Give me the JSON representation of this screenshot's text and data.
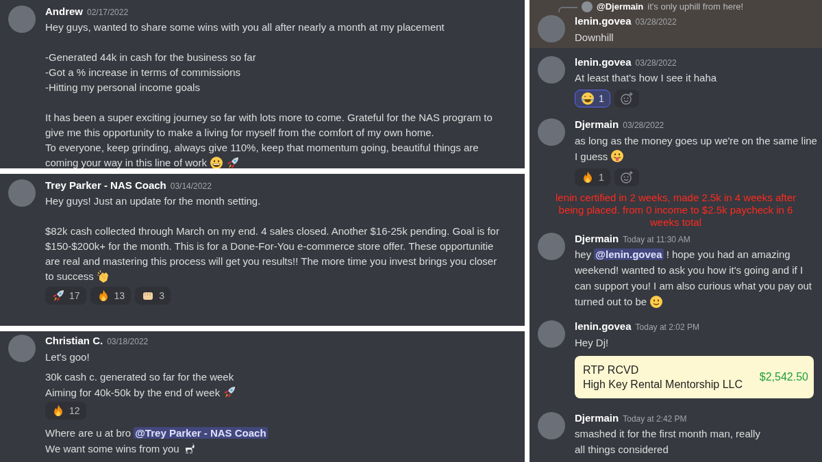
{
  "panels": [
    {
      "items": [
        {
          "kind": "message",
          "author": "Andrew",
          "timestamp": "02/17/2022",
          "paragraphs": [
            [
              {
                "text": "Hey guys, wanted to share some wins with you all after nearly a month at my placement"
              }
            ],
            [
              {
                "text": "-Generated 44k in cash for the business so far"
              },
              {
                "text": "-Got a % increase in terms of commissions"
              },
              {
                "text": "-Hitting my personal income goals"
              }
            ],
            [
              {
                "text": "It has been a super exciting journey so far with lots more to come. Grateful for the NAS program to"
              },
              {
                "text": "give me this opportunity to make a living for myself from the comfort of my own home."
              },
              {
                "text": "To everyone, keep grinding, always give 110%, keep that momentum going, beautiful things are"
              },
              {
                "text": "coming your way in this line of work",
                "emojis": [
                  {
                    "kind": "grin"
                  },
                  {
                    "kind": "rocket"
                  }
                ]
              }
            ]
          ]
        }
      ]
    },
    {
      "items": [
        {
          "kind": "message",
          "author": "Trey Parker - NAS Coach",
          "timestamp": "03/14/2022",
          "paragraphs": [
            [
              {
                "text": "Hey guys! Just an update for the month setting."
              }
            ],
            [
              {
                "text": "$82k cash collected through March on my end. 4 sales closed. Another $16-25k pending. Goal is for"
              },
              {
                "text": "$150-$200k+ for the month. This is for a Done-For-You e-commerce store offer. These opportunitie"
              },
              {
                "text": "are real and mastering this process will get you results!! The more time you invest brings you closer"
              },
              {
                "text": "to success",
                "emojis": [
                  {
                    "kind": "clap"
                  }
                ]
              }
            ]
          ],
          "reactions": [
            {
              "kind": "rocket",
              "count": "17",
              "selected": false
            },
            {
              "kind": "fire",
              "count": "13",
              "selected": false
            },
            {
              "kind": "fist",
              "count": "3",
              "selected": false
            }
          ]
        }
      ]
    },
    {
      "items": [
        {
          "kind": "message",
          "author": "Christian C.",
          "timestamp": "03/18/2022",
          "paragraphs": [
            [
              {
                "text": "Let's goo!"
              }
            ],
            [
              {
                "text": "30k cash c. generated so far for the week"
              },
              {
                "text": "Aiming for 40k-50k by the end of week",
                "emojis": [
                  {
                    "kind": "rocket"
                  }
                ]
              }
            ]
          ],
          "reactions": [
            {
              "kind": "fire",
              "count": "12",
              "selected": false
            }
          ]
        },
        {
          "kind": "continuation",
          "paragraphs": [
            [
              {
                "text": "Where are u at bro ",
                "mention": "@Trey Parker - NAS Coach"
              },
              {
                "text": "We want some wins from you",
                "emojis": [
                  {
                    "kind": "goat"
                  }
                ]
              }
            ]
          ]
        }
      ]
    },
    {
      "items": [
        {
          "kind": "message",
          "author": "lenin.govea",
          "timestamp": "03/28/2022",
          "highlighted": true,
          "reply_to": {
            "mention": "@Djermain",
            "text": "it's only uphill from here!"
          },
          "paragraphs": [
            [
              {
                "text": "Downhill"
              }
            ]
          ]
        },
        {
          "kind": "message",
          "author": "lenin.govea",
          "timestamp": "03/28/2022",
          "highlighted": false,
          "paragraphs": [
            [
              {
                "text": "At least that's how I see it haha"
              }
            ]
          ],
          "reactions": [
            {
              "kind": "joy",
              "count": "1",
              "selected": true
            }
          ],
          "add_reaction": true
        },
        {
          "kind": "message",
          "author": "Djermain",
          "timestamp": "03/28/2022",
          "highlighted": false,
          "paragraphs": [
            [
              {
                "text": "as long as the money goes up we're on the same line"
              },
              {
                "text": "I guess",
                "emojis": [
                  {
                    "kind": "tongue"
                  }
                ]
              }
            ]
          ],
          "reactions": [
            {
              "kind": "fire",
              "count": "1",
              "selected": false
            }
          ],
          "add_reaction": true
        },
        {
          "kind": "annotation",
          "text": "lenin certified in 2 weeks, made 2.5k in 4 weeks after being placed. from 0 income to $2.5k paycheck in 6 weeks total"
        },
        {
          "kind": "message",
          "author": "Djermain",
          "timestamp": "Today at 11:30 AM",
          "highlighted": false,
          "paragraphs": [
            [
              {
                "text": "hey ",
                "mention": "@lenin.govea",
                "after": " ! hope you had an amazing"
              },
              {
                "text": "weekend! wanted to ask you how it's going and if I"
              },
              {
                "text": "can support you! I am also curious what you pay out"
              },
              {
                "text": "turned out to be",
                "emojis": [
                  {
                    "kind": "smile"
                  }
                ]
              }
            ]
          ]
        },
        {
          "kind": "message",
          "author": "lenin.govea",
          "timestamp": "Today at 2:02 PM",
          "highlighted": false,
          "paragraphs": [
            [
              {
                "text": "Hey Dj!"
              }
            ]
          ],
          "embed": {
            "lines": [
              "RTP RCVD",
              "High Key Rental Mentorship LLC"
            ],
            "amount": "$2,542.50"
          }
        },
        {
          "kind": "message",
          "author": "Djermain",
          "timestamp": "Today at 2:42 PM",
          "highlighted": false,
          "paragraphs": [
            [
              {
                "text": "smashed it for the first month man, really"
              },
              {
                "text": "all things considered"
              }
            ]
          ]
        }
      ]
    }
  ]
}
